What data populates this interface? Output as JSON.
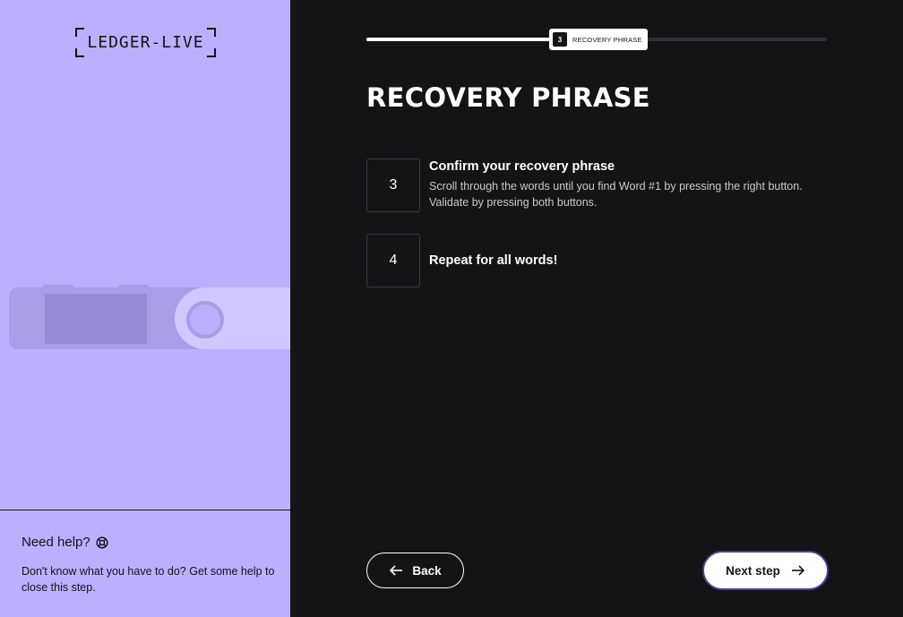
{
  "brand": {
    "logo_text": "LEDGER-LIVE"
  },
  "progress": {
    "step_number": "3",
    "step_label": "RECOVERY PHRASE",
    "fill_fraction": 0.42
  },
  "page": {
    "title": "RECOVERY PHRASE"
  },
  "steps": [
    {
      "number": "3",
      "title": "Confirm your recovery phrase",
      "description": "Scroll through the words until you find Word #1 by pressing the right button. Validate by pressing both buttons."
    },
    {
      "number": "4",
      "title": "Repeat for all words!",
      "description": ""
    }
  ],
  "help": {
    "title": "Need help?",
    "text": "Don't know what you have to do? Get some help to close this step.",
    "icon": "lifebuoy-icon"
  },
  "buttons": {
    "back_label": "Back",
    "next_label": "Next step"
  },
  "colors": {
    "left_panel_bg": "#bbb0ff",
    "main_bg": "#131415",
    "accent": "#4a3f9a"
  }
}
